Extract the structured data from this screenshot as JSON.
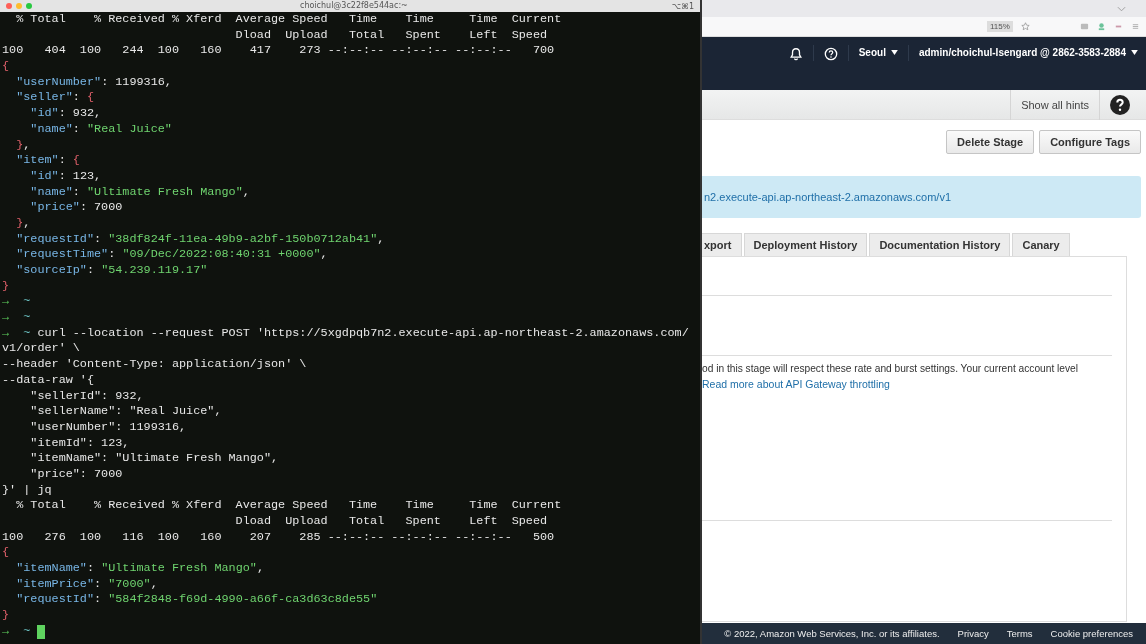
{
  "terminal": {
    "title": "choichul@3c22f8e544ac:~",
    "shortcut": "⌥⌘1",
    "cursor": true,
    "lines": [
      [
        {
          "kind": "text",
          "text": "  % Total    % Received % Xferd  Average Speed   Time    Time     Time  Current"
        }
      ],
      [
        {
          "kind": "text",
          "text": "                                 Dload  Upload   Total   Spent    Left  Speed"
        }
      ],
      [
        {
          "kind": "text",
          "text": "100   404  100   244  100   160    417    273 --:--:-- --:--:-- --:--:--   700"
        }
      ],
      [
        {
          "kind": "brace",
          "text": "{"
        }
      ],
      [
        {
          "kind": "key",
          "text": "  \"userNumber\""
        },
        {
          "kind": "text",
          "text": ": 1199316,"
        }
      ],
      [
        {
          "kind": "key",
          "text": "  \"seller\""
        },
        {
          "kind": "text",
          "text": ": "
        },
        {
          "kind": "brace",
          "text": "{"
        }
      ],
      [
        {
          "kind": "key",
          "text": "    \"id\""
        },
        {
          "kind": "text",
          "text": ": 932,"
        }
      ],
      [
        {
          "kind": "key",
          "text": "    \"name\""
        },
        {
          "kind": "text",
          "text": ": "
        },
        {
          "kind": "string",
          "text": "\"Real Juice\""
        }
      ],
      [
        {
          "kind": "brace",
          "text": "  }"
        },
        {
          "kind": "text",
          "text": ","
        }
      ],
      [
        {
          "kind": "key",
          "text": "  \"item\""
        },
        {
          "kind": "text",
          "text": ": "
        },
        {
          "kind": "brace",
          "text": "{"
        }
      ],
      [
        {
          "kind": "key",
          "text": "    \"id\""
        },
        {
          "kind": "text",
          "text": ": 123,"
        }
      ],
      [
        {
          "kind": "key",
          "text": "    \"name\""
        },
        {
          "kind": "text",
          "text": ": "
        },
        {
          "kind": "string",
          "text": "\"Ultimate Fresh Mango\""
        },
        {
          "kind": "text",
          "text": ","
        }
      ],
      [
        {
          "kind": "key",
          "text": "    \"price\""
        },
        {
          "kind": "text",
          "text": ": 7000"
        }
      ],
      [
        {
          "kind": "brace",
          "text": "  }"
        },
        {
          "kind": "text",
          "text": ","
        }
      ],
      [
        {
          "kind": "key",
          "text": "  \"requestId\""
        },
        {
          "kind": "text",
          "text": ": "
        },
        {
          "kind": "string",
          "text": "\"38df824f-11ea-49b9-a2bf-150b0712ab41\""
        },
        {
          "kind": "text",
          "text": ","
        }
      ],
      [
        {
          "kind": "key",
          "text": "  \"requestTime\""
        },
        {
          "kind": "text",
          "text": ": "
        },
        {
          "kind": "string",
          "text": "\"09/Dec/2022:08:40:31 +0000\""
        },
        {
          "kind": "text",
          "text": ","
        }
      ],
      [
        {
          "kind": "key",
          "text": "  \"sourceIp\""
        },
        {
          "kind": "text",
          "text": ": "
        },
        {
          "kind": "string",
          "text": "\"54.239.119.17\""
        }
      ],
      [
        {
          "kind": "brace",
          "text": "}"
        }
      ],
      [
        {
          "kind": "prompt",
          "text": "→"
        },
        {
          "kind": "dir",
          "text": "  ~"
        }
      ],
      [
        {
          "kind": "prompt",
          "text": "→"
        },
        {
          "kind": "dir",
          "text": "  ~"
        }
      ],
      [
        {
          "kind": "prompt",
          "text": "→"
        },
        {
          "kind": "dir",
          "text": "  ~"
        },
        {
          "kind": "text",
          "text": " curl --location --request POST 'https://5xgdpqb7n2.execute-api.ap-northeast-2.amazonaws.com/"
        }
      ],
      [
        {
          "kind": "text",
          "text": "v1/order' \\"
        }
      ],
      [
        {
          "kind": "text",
          "text": "--header 'Content-Type: application/json' \\"
        }
      ],
      [
        {
          "kind": "text",
          "text": "--data-raw '{"
        }
      ],
      [
        {
          "kind": "text",
          "text": "    \"sellerId\": 932,"
        }
      ],
      [
        {
          "kind": "text",
          "text": "    \"sellerName\": \"Real Juice\","
        }
      ],
      [
        {
          "kind": "text",
          "text": "    \"userNumber\": 1199316,"
        }
      ],
      [
        {
          "kind": "text",
          "text": "    \"itemId\": 123,"
        }
      ],
      [
        {
          "kind": "text",
          "text": "    \"itemName\": \"Ultimate Fresh Mango\","
        }
      ],
      [
        {
          "kind": "text",
          "text": "    \"price\": 7000"
        }
      ],
      [
        {
          "kind": "text",
          "text": "}' | jq"
        }
      ],
      [
        {
          "kind": "text",
          "text": "  % Total    % Received % Xferd  Average Speed   Time    Time     Time  Current"
        }
      ],
      [
        {
          "kind": "text",
          "text": "                                 Dload  Upload   Total   Spent    Left  Speed"
        }
      ],
      [
        {
          "kind": "text",
          "text": "100   276  100   116  100   160    207    285 --:--:-- --:--:-- --:--:--   500"
        }
      ],
      [
        {
          "kind": "brace",
          "text": "{"
        }
      ],
      [
        {
          "kind": "key",
          "text": "  \"itemName\""
        },
        {
          "kind": "text",
          "text": ": "
        },
        {
          "kind": "string",
          "text": "\"Ultimate Fresh Mango\""
        },
        {
          "kind": "text",
          "text": ","
        }
      ],
      [
        {
          "kind": "key",
          "text": "  \"itemPrice\""
        },
        {
          "kind": "text",
          "text": ": "
        },
        {
          "kind": "string",
          "text": "\"7000\""
        },
        {
          "kind": "text",
          "text": ","
        }
      ],
      [
        {
          "kind": "key",
          "text": "  \"requestId\""
        },
        {
          "kind": "text",
          "text": ": "
        },
        {
          "kind": "string",
          "text": "\"584f2848-f69d-4990-a66f-ca3d63c8de55\""
        }
      ],
      [
        {
          "kind": "brace",
          "text": "}"
        }
      ],
      [
        {
          "kind": "prompt",
          "text": "→"
        },
        {
          "kind": "dir",
          "text": "  ~"
        }
      ]
    ]
  },
  "browser": {
    "zoom": "115%",
    "header": {
      "region": "Seoul",
      "account": "admin/choichul-Isengard @ 2862-3583-2884"
    },
    "hints_button": "Show all hints",
    "buttons": [
      "Delete Stage",
      "Configure Tags"
    ],
    "invoke_url": "n2.execute-api.ap-northeast-2.amazonaws.com/v1",
    "tabs": [
      {
        "label": "xport",
        "selected": false
      },
      {
        "label": "Deployment History",
        "selected": false
      },
      {
        "label": "Documentation History",
        "selected": false
      },
      {
        "label": "Canary",
        "selected": false
      }
    ],
    "throttling_text": "od in this stage will respect these rate and burst settings. Your current account level",
    "throttling_link": "Read more about API Gateway throttling",
    "footer": {
      "copyright": "© 2022, Amazon Web Services, Inc. or its affiliates.",
      "links": [
        "Privacy",
        "Terms",
        "Cookie preferences"
      ]
    }
  }
}
